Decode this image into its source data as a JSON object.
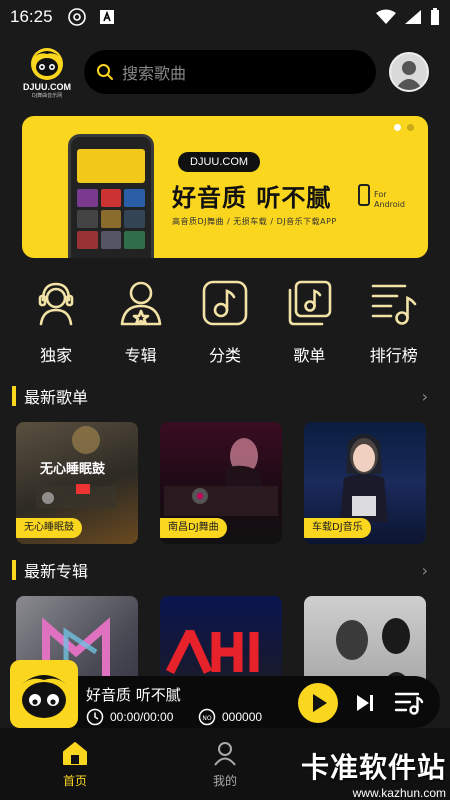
{
  "status_bar": {
    "time": "16:25"
  },
  "header": {
    "logo_text": "DJUU.COM",
    "logo_sub": "DJ舞曲音乐网",
    "search_placeholder": "搜索歌曲"
  },
  "banner": {
    "domain": "DJUU.COM",
    "headline": "好音质 听不腻",
    "for_line1": "For",
    "for_line2": "Android",
    "tagline": "高音质DJ舞曲 / 无损车载 / DJ音乐下载APP",
    "page_count": 2,
    "active_page": 1
  },
  "categories": [
    {
      "label": "独家",
      "icon": "headphones-person-icon"
    },
    {
      "label": "专辑",
      "icon": "person-star-icon"
    },
    {
      "label": "分类",
      "icon": "music-note-square-icon"
    },
    {
      "label": "歌单",
      "icon": "stacked-music-icon"
    },
    {
      "label": "排行榜",
      "icon": "ranking-list-icon"
    }
  ],
  "playlists_section": {
    "title": "最新歌单",
    "more": "›",
    "cards": [
      {
        "tag": "无心睡眠鼓",
        "overlay": "无心睡眠鼓"
      },
      {
        "tag": "南昌DJ舞曲",
        "overlay": ""
      },
      {
        "tag": "车载DJ音乐",
        "overlay": ""
      }
    ]
  },
  "albums_section": {
    "title": "最新专辑",
    "more": "›"
  },
  "player": {
    "title": "好音质 听不腻",
    "time": "00:00/00:00",
    "count": "000000"
  },
  "bottom_nav": [
    {
      "label": "首页",
      "active": true
    },
    {
      "label": "我的",
      "active": false
    }
  ],
  "watermark": {
    "title": "卡准软件站",
    "url": "www.kazhun.com"
  },
  "colors": {
    "accent": "#fbd61e",
    "background": "#1a1a1a"
  }
}
